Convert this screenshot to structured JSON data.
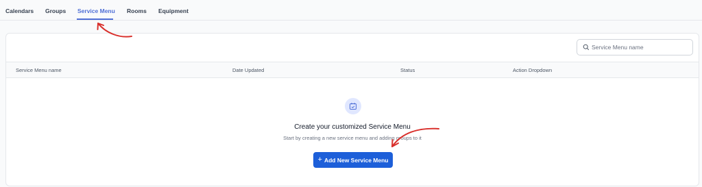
{
  "tabs": [
    {
      "label": "Calendars",
      "active": false
    },
    {
      "label": "Groups",
      "active": false
    },
    {
      "label": "Service Menu",
      "active": true
    },
    {
      "label": "Rooms",
      "active": false
    },
    {
      "label": "Equipment",
      "active": false
    }
  ],
  "search": {
    "placeholder": "Service Menu name",
    "value": "",
    "icon": "search-icon"
  },
  "table": {
    "columns": [
      "Service Menu name",
      "Date Updated",
      "Status",
      "Action Dropdown"
    ],
    "rows": []
  },
  "empty_state": {
    "icon": "calendar-check-icon",
    "title": "Create your customized Service Menu",
    "subtitle": "Start by creating a new service menu and adding groups to it",
    "button_label": "Add New Service Menu",
    "button_icon": "plus-icon"
  },
  "colors": {
    "accent": "#4f6fd6",
    "button": "#1d5fd9",
    "annotation_arrow": "#d9302c"
  }
}
